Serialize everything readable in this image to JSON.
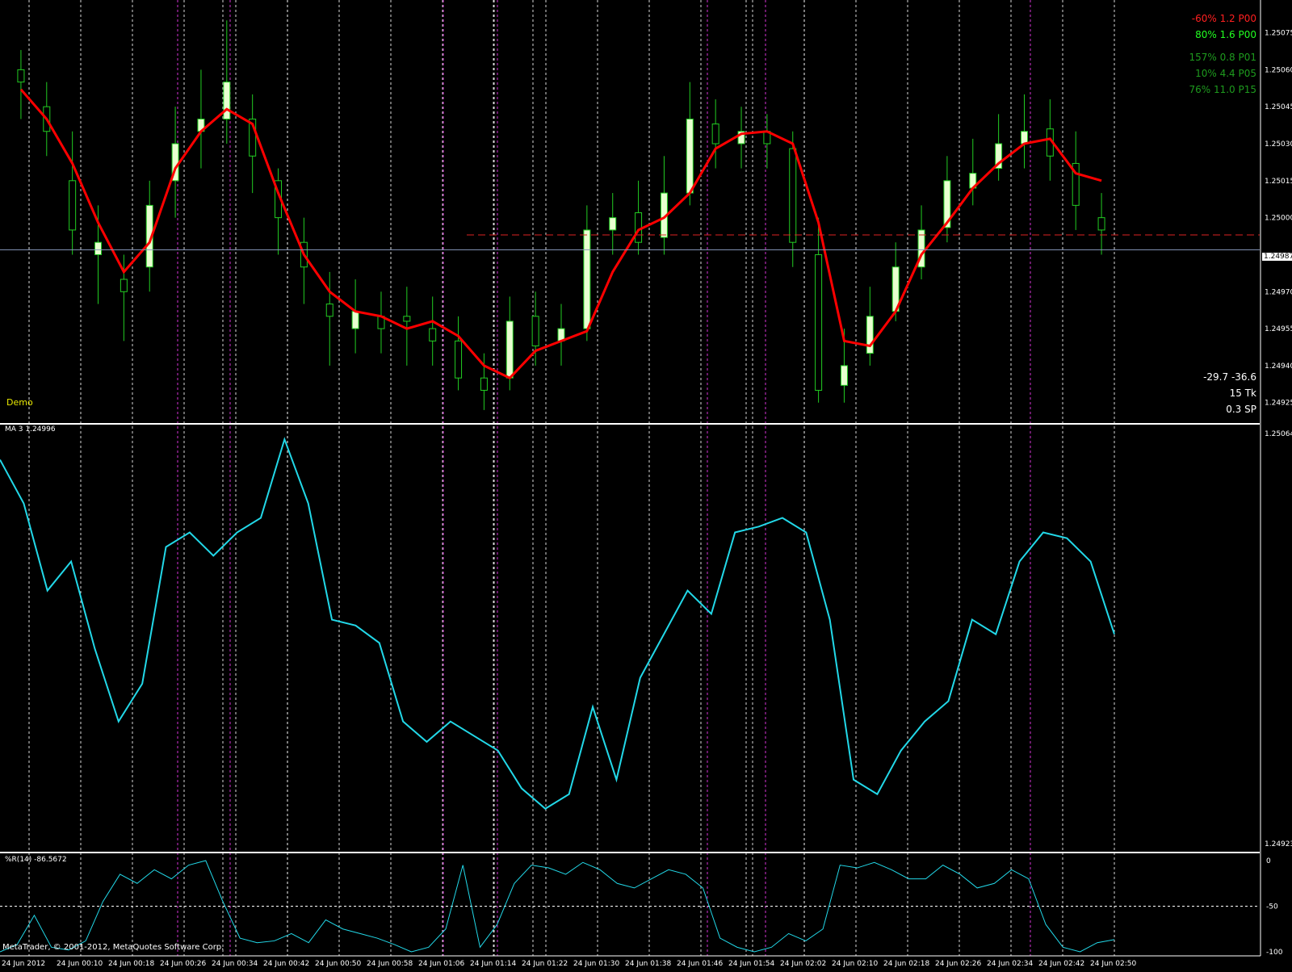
{
  "colors": {
    "background": "#000000",
    "grid": "#ffffff",
    "session_line": "#d633d6",
    "bull_candle": "#e8ffd0",
    "bear_candle": "#000000",
    "wick": "#22cc22",
    "ma_line": "#ff0000",
    "indicator_line": "#22d8e8",
    "price_line": "#8899bb",
    "alert_line": "#dd2222"
  },
  "main_panel": {
    "demo_label": "Demo",
    "stats_top": [
      {
        "text": "-60% 1.2 P00",
        "color": "#ff2020"
      },
      {
        "text": "80% 1.6 P00",
        "color": "#22ff22"
      },
      {
        "text": "157% 0.8 P01",
        "color": "#1e9b1e"
      },
      {
        "text": "10% 4.4 P05",
        "color": "#1e9b1e"
      },
      {
        "text": "76% 11.0 P15",
        "color": "#1e9b1e"
      }
    ],
    "stats_bottom": [
      "-29.7  -36.6",
      "15 Tk",
      "0.3 SP"
    ],
    "current_price": "1.24987"
  },
  "ma_panel": {
    "label": "MA 3 1.24996",
    "scale_top": "1.25064",
    "scale_bottom": "1.24923"
  },
  "wpr_panel": {
    "label": "%R(14) -86.5672",
    "scale": [
      "0",
      "-50",
      "-100"
    ]
  },
  "footer": {
    "copyright": "MetaTrader, © 2001-2012, MetaQuotes Software Corp."
  },
  "chart_data": [
    {
      "type": "candlestick",
      "title": "",
      "y_ticks": [
        1.25075,
        1.2506,
        1.25045,
        1.2503,
        1.25015,
        1.25,
        1.2497,
        1.24955,
        1.2494,
        1.24925
      ],
      "ylim": [
        1.2492,
        1.25085
      ],
      "x_ticks": [
        "24 Jun 2012",
        "24 Jun 00:10",
        "24 Jun 00:18",
        "24 Jun 00:26",
        "24 Jun 00:34",
        "24 Jun 00:42",
        "24 Jun 00:50",
        "24 Jun 00:58",
        "24 Jun 01:06",
        "24 Jun 01:14",
        "24 Jun 01:22",
        "24 Jun 01:30",
        "24 Jun 01:38",
        "24 Jun 01:46",
        "24 Jun 01:54",
        "24 Jun 02:02",
        "24 Jun 02:10",
        "24 Jun 02:18",
        "24 Jun 02:26",
        "24 Jun 02:34",
        "24 Jun 02:42",
        "24 Jun 02:50"
      ],
      "series": [
        {
          "name": "MA",
          "values": [
            1.25052,
            1.2504,
            1.25022,
            1.24998,
            1.24978,
            1.2499,
            1.2502,
            1.25035,
            1.25044,
            1.25038,
            1.2501,
            1.24985,
            1.2497,
            1.24962,
            1.2496,
            1.24955,
            1.24958,
            1.24952,
            1.2494,
            1.24935,
            1.24946,
            1.2495,
            1.24954,
            1.24978,
            1.24995,
            1.25,
            1.2501,
            1.25028,
            1.25034,
            1.25035,
            1.2503,
            1.24998,
            1.2495,
            1.24948,
            1.24962,
            1.24985,
            1.24998,
            1.25012,
            1.25022,
            1.2503,
            1.25032,
            1.25018,
            1.25015
          ]
        },
        {
          "name": "Close",
          "values": [
            1.25055,
            1.25035,
            1.24995,
            1.2499,
            1.2497,
            1.25005,
            1.2503,
            1.2504,
            1.25055,
            1.25025,
            1.25,
            1.2498,
            1.2496,
            1.24962,
            1.24955,
            1.24958,
            1.2495,
            1.24935,
            1.2493,
            1.24958,
            1.24948,
            1.24955,
            1.24995,
            1.25,
            1.2499,
            1.2501,
            1.2504,
            1.2503,
            1.25035,
            1.2503,
            1.2499,
            1.2493,
            1.2494,
            1.2496,
            1.2498,
            1.24995,
            1.25015,
            1.25018,
            1.2503,
            1.25035,
            1.25025,
            1.25005,
            1.24995
          ]
        },
        {
          "name": "Open",
          "values": [
            1.2506,
            1.25045,
            1.25015,
            1.24985,
            1.24975,
            1.2498,
            1.25015,
            1.25035,
            1.2504,
            1.2504,
            1.25015,
            1.2499,
            1.24965,
            1.24955,
            1.2496,
            1.2496,
            1.24955,
            1.2495,
            1.24935,
            1.24935,
            1.2496,
            1.2495,
            1.24955,
            1.24995,
            1.25002,
            1.24992,
            1.2501,
            1.25038,
            1.2503,
            1.25035,
            1.25028,
            1.24985,
            1.24932,
            1.24945,
            1.24962,
            1.2498,
            1.24996,
            1.25012,
            1.2502,
            1.2503,
            1.25036,
            1.25022,
            1.25
          ]
        },
        {
          "name": "High",
          "values": [
            1.25068,
            1.25055,
            1.25035,
            1.25005,
            1.24985,
            1.25015,
            1.25045,
            1.2506,
            1.2508,
            1.2505,
            1.2502,
            1.25,
            1.24978,
            1.24975,
            1.2497,
            1.24972,
            1.24968,
            1.2496,
            1.24945,
            1.24968,
            1.2497,
            1.24965,
            1.25005,
            1.2501,
            1.25015,
            1.25025,
            1.25055,
            1.25048,
            1.25045,
            1.25042,
            1.25035,
            1.25,
            1.24955,
            1.24972,
            1.2499,
            1.25005,
            1.25025,
            1.25032,
            1.25042,
            1.2505,
            1.25048,
            1.25035,
            1.2501
          ]
        },
        {
          "name": "Low",
          "values": [
            1.2504,
            1.25025,
            1.24985,
            1.24965,
            1.2495,
            1.2497,
            1.25,
            1.2502,
            1.2503,
            1.2501,
            1.24985,
            1.24965,
            1.2494,
            1.24945,
            1.24945,
            1.2494,
            1.2494,
            1.2493,
            1.24922,
            1.2493,
            1.2494,
            1.2494,
            1.2495,
            1.24985,
            1.24985,
            1.24985,
            1.25005,
            1.2502,
            1.2502,
            1.2502,
            1.2498,
            1.24925,
            1.24925,
            1.2494,
            1.24958,
            1.24975,
            1.2499,
            1.25005,
            1.25015,
            1.2502,
            1.25015,
            1.24995,
            1.24985
          ]
        }
      ]
    },
    {
      "type": "line",
      "title": "MA 3 1.24996",
      "ylim": [
        1.24923,
        1.25064
      ],
      "series": [
        {
          "name": "MA 3",
          "values": [
            1.25055,
            1.2504,
            1.2501,
            1.2502,
            1.2499,
            1.24965,
            1.24978,
            1.25025,
            1.2503,
            1.25022,
            1.2503,
            1.25035,
            1.25062,
            1.2504,
            1.25,
            1.24998,
            1.24992,
            1.24965,
            1.24958,
            1.24965,
            1.2496,
            1.24955,
            1.24942,
            1.24935,
            1.2494,
            1.2497,
            1.24945,
            1.2498,
            1.24995,
            1.2501,
            1.25002,
            1.2503,
            1.25032,
            1.25035,
            1.2503,
            1.25,
            1.24945,
            1.2494,
            1.24955,
            1.24965,
            1.24972,
            1.25,
            1.24995,
            1.2502,
            1.2503,
            1.25028,
            1.2502,
            1.24995
          ]
        }
      ]
    },
    {
      "type": "line",
      "title": "%R(14) -86.5672",
      "ylim": [
        -100,
        0
      ],
      "series": [
        {
          "name": "%R(14)",
          "values": [
            -100,
            -92,
            -60,
            -95,
            -98,
            -88,
            -45,
            -15,
            -25,
            -10,
            -20,
            -5,
            0,
            -45,
            -85,
            -90,
            -88,
            -80,
            -90,
            -65,
            -75,
            -80,
            -85,
            -92,
            -100,
            -95,
            -75,
            -5,
            -95,
            -70,
            -25,
            -5,
            -8,
            -15,
            -2,
            -10,
            -25,
            -30,
            -20,
            -10,
            -15,
            -30,
            -85,
            -95,
            -100,
            -95,
            -80,
            -88,
            -75,
            -5,
            -8,
            -2,
            -10,
            -20,
            -20,
            -5,
            -15,
            -30,
            -25,
            -10,
            -20,
            -70,
            -95,
            -100,
            -90,
            -86.5672
          ]
        }
      ]
    }
  ]
}
